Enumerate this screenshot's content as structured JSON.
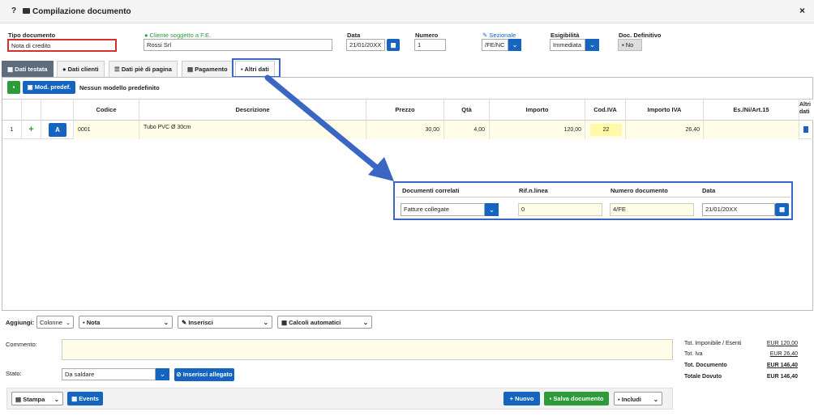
{
  "header": {
    "help": "?",
    "title": "Compilazione documento",
    "close": "×"
  },
  "form": {
    "tipo_label": "Tipo documento",
    "tipo_value": "Nota di credito",
    "cliente_label": "Cliente soggetto a F.E.",
    "cliente_value": "Rossi Srl",
    "data_label": "Data",
    "data_value": "21/01/20XX",
    "numero_label": "Numero",
    "numero_value": "1",
    "sezionale_label": "Sezionale",
    "sezionale_value": "/FE/NC",
    "esig_label": "Esigibilità",
    "esig_value": "Immediata",
    "docdef_label": "Doc. Definitivo",
    "docdef_value": "No"
  },
  "tabs": [
    "Dati testata",
    "Dati clienti",
    "Dati piè di pagina",
    "Pagamento",
    "Altri dati"
  ],
  "toolbar": {
    "mod_label": "Mod. predef.",
    "nessun": "Nessun modello predefinito"
  },
  "table": {
    "headers": [
      "Codice",
      "Descrizione",
      "Prezzo",
      "Qtà",
      "Importo",
      "Cod.IVA",
      "Importo IVA",
      "Es./Ni/Art.15",
      "Altri dati"
    ],
    "row": {
      "num": "1",
      "a": "A",
      "codice": "0001",
      "descrizione": "Tubo PVC Ø 30cm",
      "prezzo": "30,00",
      "qta": "4,00",
      "importo": "120,00",
      "codiva": "22",
      "importoiva": "26,40",
      "es": ""
    }
  },
  "popup": {
    "headers": [
      "Documenti correlati",
      "Rif.n.linea",
      "Numero documento",
      "Data"
    ],
    "doc_corr": "Fatture collegate",
    "rif": "0",
    "numdoc": "4/FE",
    "data": "21/01/20XX"
  },
  "aggiungi": {
    "label": "Aggiungi:",
    "colonne": "Colonne",
    "nota": "Nota",
    "inserisci": "Inserisci",
    "calcoli": "Calcoli automatici"
  },
  "commento_label": "Commento:",
  "stato": {
    "label": "Stato:",
    "value": "Da saldare",
    "allegato": "Inserisci allegato"
  },
  "totals": {
    "imponibile_label": "Tot. Imponibile / Esenti",
    "imponibile": "EUR 120,00",
    "iva_label": "Tot. Iva",
    "iva": "EUR 26,40",
    "documento_label": "Tot. Documento",
    "documento": "EUR 146,40",
    "dovuto_label": "Totale Dovuto",
    "dovuto": "EUR 146,40"
  },
  "footer": {
    "stampa": "Stampa",
    "events": "Events",
    "nuovo": "Nuovo",
    "salva": "Salva documento",
    "includi": "Includi"
  },
  "colors": {
    "accent": "#1565c0",
    "green": "#2e9b3a",
    "highlight": "#3a67c4",
    "error": "#d32f2f"
  }
}
